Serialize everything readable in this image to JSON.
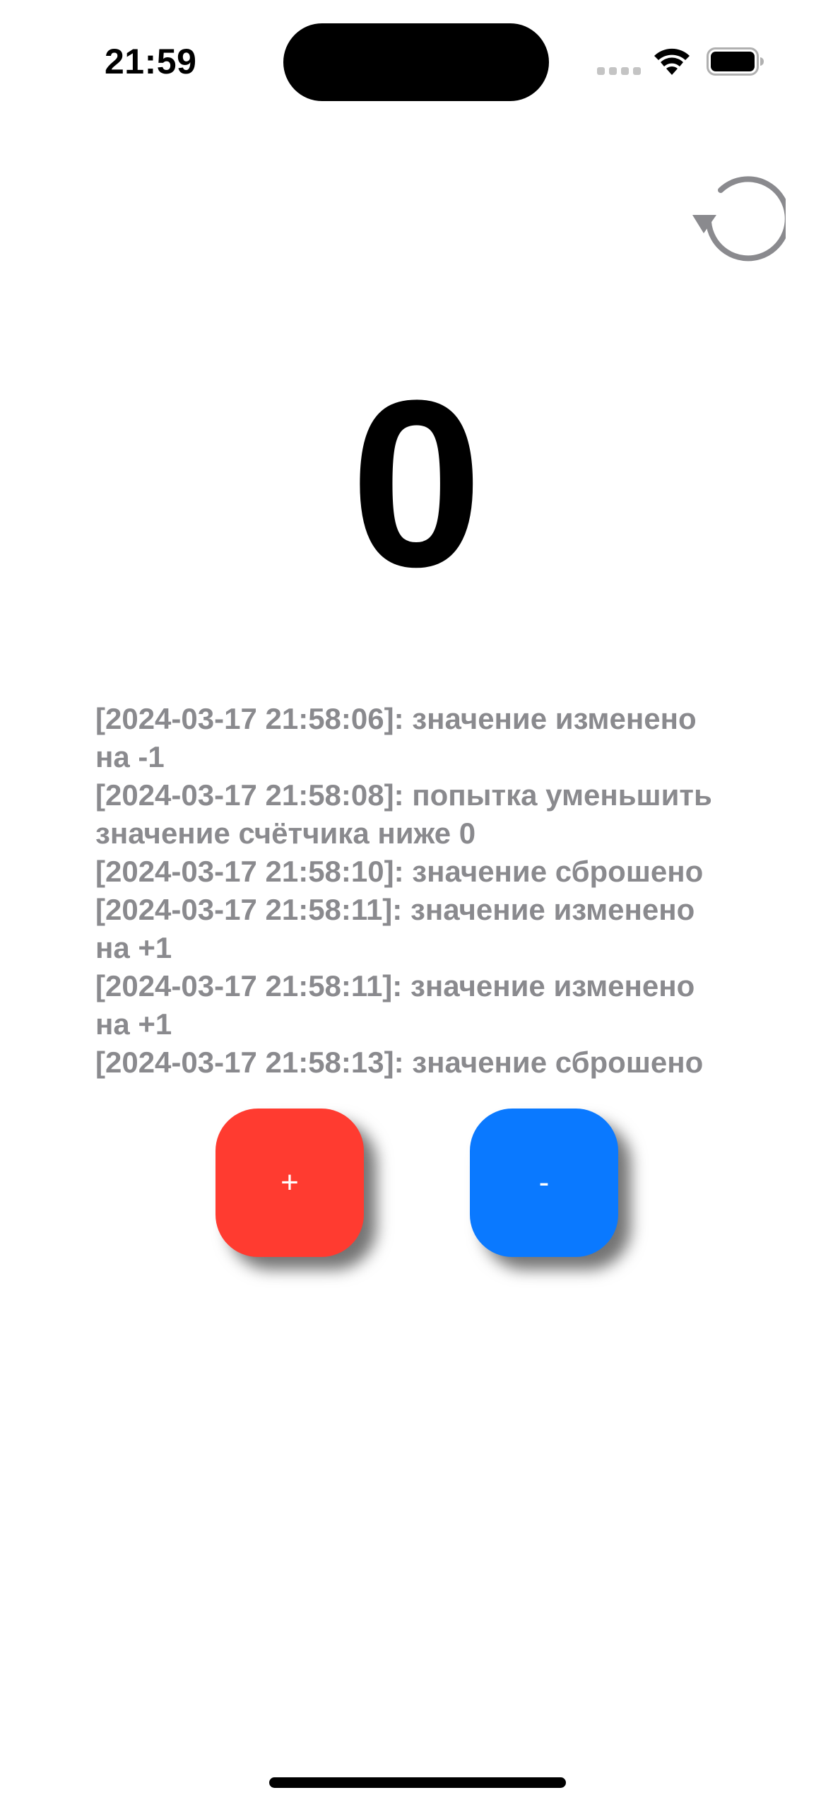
{
  "status_bar": {
    "time": "21:59"
  },
  "toolbar": {
    "reset_icon": "arrow-counterclockwise-circle"
  },
  "counter": {
    "value": "0"
  },
  "history": {
    "entries": [
      "[2024-03-17 21:58:06]: значение изменено на -1",
      "[2024-03-17 21:58:08]: попытка уменьшить значение счётчика ниже 0",
      "[2024-03-17 21:58:10]: значение сброшено",
      "[2024-03-17 21:58:11]: значение изменено на +1",
      "[2024-03-17 21:58:11]: значение изменено на +1",
      "[2024-03-17 21:58:13]: значение сброшено"
    ]
  },
  "buttons": {
    "increment_label": "+",
    "decrement_label": "-"
  },
  "colors": {
    "increment": "#ff3b30",
    "decrement": "#0a79ff",
    "log_text": "#8a8a8e",
    "reset_icon": "#8a8a8e"
  }
}
